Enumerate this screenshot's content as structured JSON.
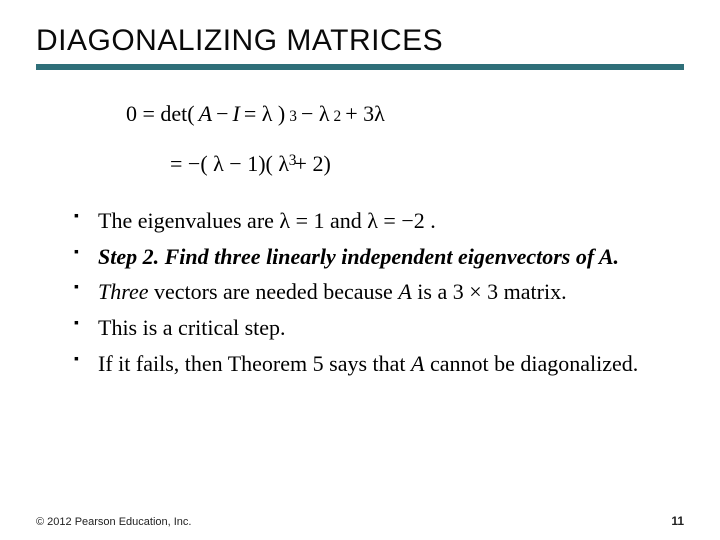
{
  "title": "DIAGONALIZING MATRICES",
  "eq": {
    "line1_lhs": "0 = det(",
    "line1_A": "A",
    "line1_minus": " − ",
    "line1_I": "I",
    "line1_eq": "   = λ  )",
    "line1_sup1": "3",
    "line1_after1": " −    λ ",
    "line1_sup2": "2",
    "line1_after2": " + 3λ",
    "line2_lhs": "= −(   λ −   1)( λ +   2)",
    "line2_sup": "3"
  },
  "bullets": {
    "b1_pre": "The eigenvalues are ",
    "b1_eq1": "λ = 1",
    "b1_mid": " and ",
    "b1_eq2": "λ = −2",
    "b1_post": ".",
    "b2": "Step 2. Find three linearly independent eigenvectors of A.",
    "b3_pre": "Three",
    "b3_mid": " vectors are needed because ",
    "b3_A": "A",
    "b3_is": " is a ",
    "b3_dim": "3 × 3",
    "b3_post": " matrix.",
    "b4": "This is a critical step.",
    "b5_pre": "If it fails, then Theorem 5 says that ",
    "b5_A": "A",
    "b5_post": " cannot be diagonalized."
  },
  "footer": {
    "copyright": "© 2012 Pearson Education, Inc.",
    "page": "11"
  }
}
